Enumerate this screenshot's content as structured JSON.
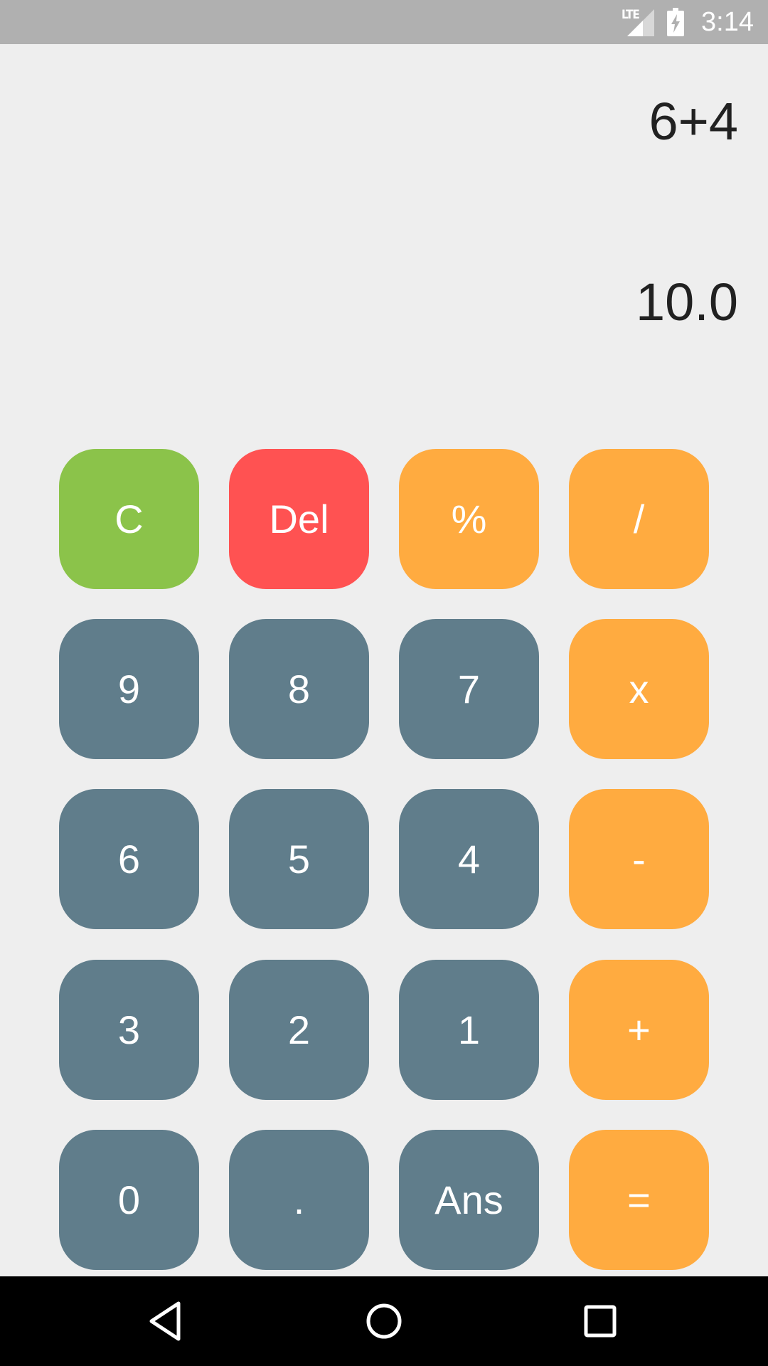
{
  "status_bar": {
    "network": "LTE",
    "time": "3:14"
  },
  "display": {
    "expression": "6+4",
    "result": "10.0"
  },
  "colors": {
    "clear": "#8bc34a",
    "delete": "#ff5252",
    "operator": "#ffab40",
    "digit": "#607d8b",
    "background": "#eeeeee"
  },
  "keys": {
    "clear": "C",
    "delete": "Del",
    "percent": "%",
    "divide": "/",
    "nine": "9",
    "eight": "8",
    "seven": "7",
    "multiply": "x",
    "six": "6",
    "five": "5",
    "four": "4",
    "minus": "-",
    "three": "3",
    "two": "2",
    "one": "1",
    "plus": "+",
    "zero": "0",
    "decimal": ".",
    "answer": "Ans",
    "equals": "="
  },
  "nav": {
    "back_icon": "triangle-back-icon",
    "home_icon": "circle-home-icon",
    "recents_icon": "square-recents-icon"
  }
}
